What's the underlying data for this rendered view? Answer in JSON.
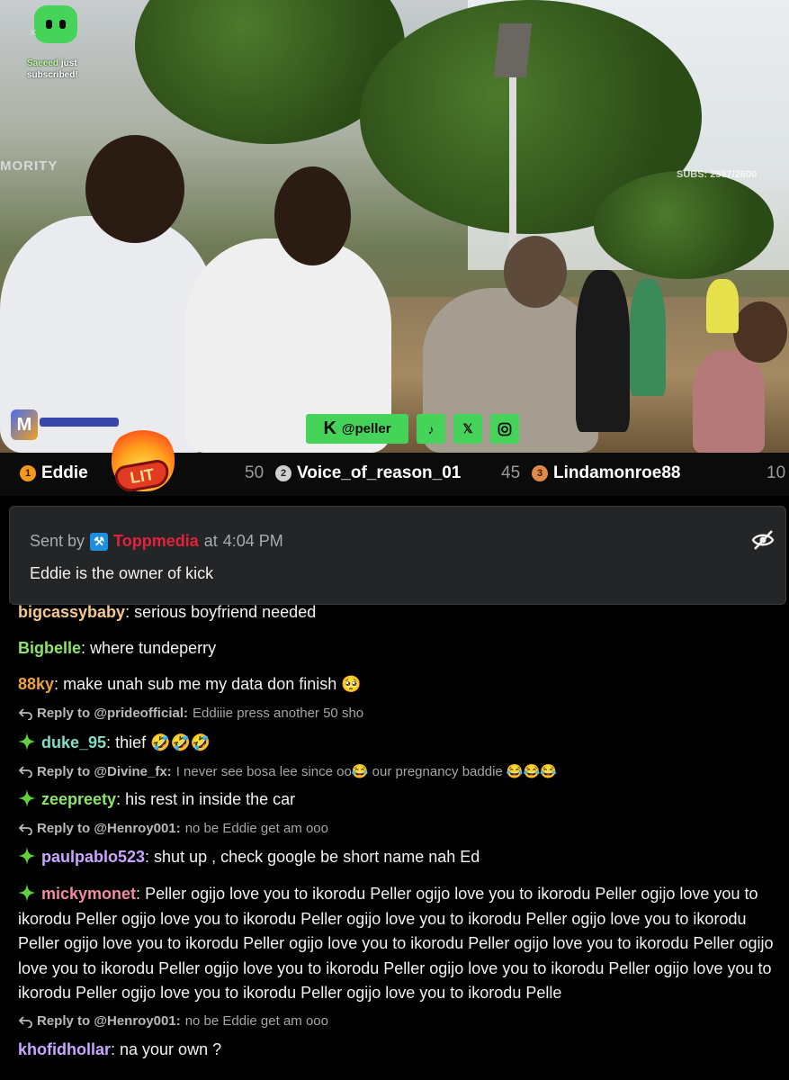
{
  "overlay": {
    "subscriber_name": "Saeeed",
    "subscriber_text": "just subscribed!",
    "watermark": "MORITY",
    "subs_counter": "SUBS: 2587/2600",
    "social_handle": "@peller",
    "social_icons": [
      "kick-icon",
      "tiktok-icon",
      "x-icon",
      "instagram-icon"
    ]
  },
  "leaderboard": {
    "entries": [
      {
        "rank": "1",
        "name": "Eddie",
        "points": "50"
      },
      {
        "rank": "2",
        "name": "Voice_of_reason_01",
        "points": "45"
      },
      {
        "rank": "3",
        "name": "Lindamonroe88",
        "points": "10"
      }
    ],
    "sticker": "LIT"
  },
  "pinned": {
    "sent_by_label": "Sent by",
    "sender": "Toppmedia",
    "at_label": "at",
    "time": "4:04 PM",
    "text": "Eddie is the owner of kick"
  },
  "chat": {
    "reply_label": "Reply to",
    "messages": [
      {
        "user": "bigcassybaby",
        "color": "#f6c88b",
        "text": "serious boyfriend needed"
      },
      {
        "user": "Bigbelle",
        "color": "#8de46a",
        "text": "where tundeperry"
      },
      {
        "user": "88ky",
        "color": "#f0a23a",
        "text": "make unah sub me my data don finish 🥺"
      },
      {
        "reply_to": "@prideofficial:",
        "reply_text": "Eddiiie press another 50 sho"
      },
      {
        "user": "duke_95",
        "color": "#7fe0c8",
        "text": "thief 🤣🤣🤣",
        "badge": "sparkle-icon"
      },
      {
        "reply_to": "@Divine_fx:",
        "reply_text": "I never see bosa lee since oo😂 our pregnancy baddie 😂😂😂"
      },
      {
        "user": "zeepreety",
        "color": "#8de46a",
        "text": "his rest in inside the car",
        "badge": "sparkle-icon"
      },
      {
        "reply_to": "@Henroy001:",
        "reply_text": "no be Eddie get am ooo"
      },
      {
        "user": "paulpablo523",
        "color": "#c9a6ff",
        "text": "shut up , check google be short name nah Ed",
        "badge": "sparkle-icon"
      },
      {
        "user": "mickymonet",
        "color": "#f28aa4",
        "text": "Peller ogijo love you to ikorodu Peller ogijo love you to ikorodu Peller ogijo love you to ikorodu Peller ogijo love you to ikorodu Peller ogijo love you to ikorodu Peller ogijo love you to ikorodu Peller ogijo love you to ikorodu Peller ogijo love you to ikorodu Peller ogijo love you to ikorodu Peller ogijo love you to ikorodu Peller ogijo love you to ikorodu Peller ogijo love you to ikorodu Peller ogijo love you to ikorodu Peller ogijo love you to ikorodu Peller ogijo love you to ikorodu Pelle",
        "badge": "sparkle-icon"
      },
      {
        "reply_to": "@Henroy001:",
        "reply_text": "no be Eddie get am ooo"
      },
      {
        "user": "khofidhollar",
        "color": "#c9a6ff",
        "text": "na your own ?"
      }
    ]
  }
}
